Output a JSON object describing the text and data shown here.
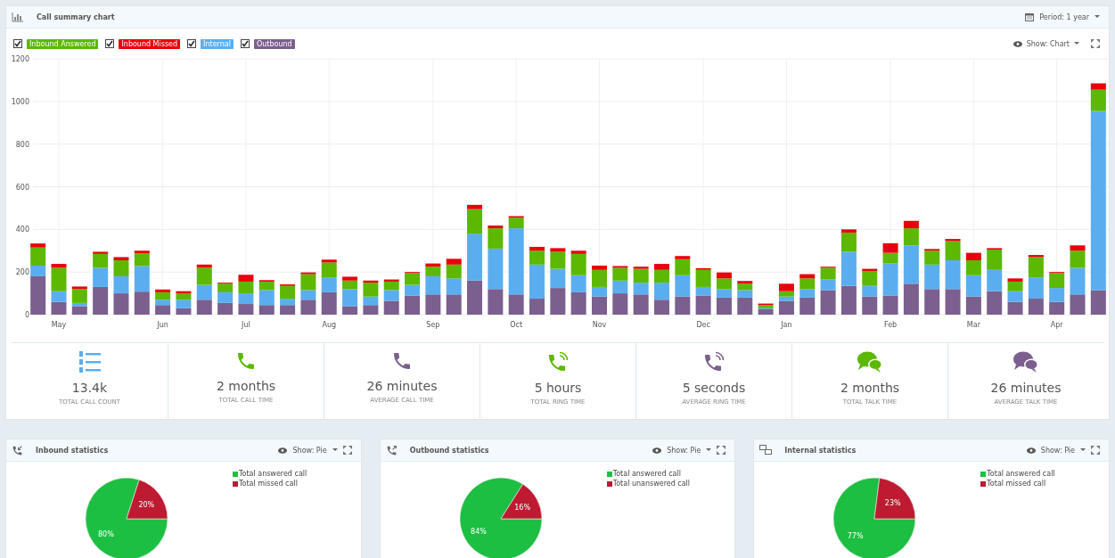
{
  "summary": {
    "title": "Call summary chart",
    "period": "Period: 1 year",
    "show": "Show: Chart",
    "legend": [
      {
        "checked": true
      },
      {
        "checked": true
      },
      {
        "checked": true
      },
      {
        "checked": true
      }
    ],
    "chart_data": {
      "type": "bar",
      "stacked": true,
      "orientation": "vertical",
      "categories": [
        null,
        "May",
        null,
        null,
        null,
        null,
        "Jun",
        null,
        null,
        null,
        "Jul",
        null,
        null,
        null,
        "Aug",
        null,
        null,
        null,
        null,
        "Sep",
        null,
        null,
        null,
        "Oct",
        null,
        null,
        null,
        "Nov",
        null,
        null,
        null,
        null,
        "Dec",
        null,
        null,
        null,
        "Jan",
        null,
        null,
        null,
        null,
        "Feb",
        null,
        null,
        null,
        "Mar",
        null,
        null,
        null,
        "Apr",
        null,
        null
      ],
      "ylim": [
        0,
        1200
      ],
      "yticks": [
        0,
        200,
        400,
        600,
        800,
        1000,
        1200
      ],
      "grid": true,
      "series": [
        {
          "name": "Outbound",
          "color": "#7b5f8e",
          "values": [
            180,
            60,
            40,
            130,
            100,
            108,
            45,
            30,
            70,
            55,
            50,
            45,
            45,
            70,
            105,
            40,
            45,
            65,
            90,
            95,
            95,
            160,
            120,
            95,
            75,
            125,
            105,
            85,
            100,
            95,
            70,
            85,
            90,
            80,
            80,
            25,
            65,
            80,
            115,
            135,
            85,
            90,
            145,
            120,
            120,
            85,
            110,
            60,
            75,
            60,
            95,
            115
          ]
        },
        {
          "name": "Internal",
          "color": "#5aaef0",
          "values": [
            50,
            50,
            15,
            90,
            80,
            120,
            25,
            40,
            70,
            50,
            50,
            70,
            30,
            45,
            70,
            80,
            40,
            50,
            50,
            85,
            75,
            220,
            190,
            310,
            160,
            90,
            80,
            45,
            60,
            55,
            80,
            100,
            40,
            40,
            35,
            5,
            20,
            40,
            50,
            160,
            50,
            150,
            180,
            115,
            135,
            100,
            100,
            50,
            100,
            65,
            125,
            840
          ]
        },
        {
          "name": "Inbound Answered",
          "color": "#5cb800",
          "values": [
            85,
            110,
            65,
            65,
            75,
            60,
            35,
            30,
            80,
            40,
            55,
            40,
            60,
            75,
            70,
            40,
            65,
            40,
            55,
            45,
            65,
            115,
            95,
            50,
            65,
            80,
            100,
            80,
            60,
            65,
            60,
            75,
            80,
            50,
            30,
            15,
            25,
            50,
            55,
            90,
            70,
            50,
            80,
            65,
            90,
            70,
            95,
            45,
            95,
            70,
            80,
            100
          ]
        },
        {
          "name": "Inbound Missed",
          "color": "#e8000b",
          "values": [
            19,
            18,
            12,
            10,
            15,
            12,
            13,
            10,
            15,
            5,
            32,
            7,
            7,
            8,
            13,
            18,
            10,
            10,
            5,
            15,
            27,
            20,
            13,
            7,
            18,
            17,
            15,
            20,
            8,
            10,
            28,
            15,
            8,
            28,
            13,
            7,
            35,
            20,
            5,
            15,
            10,
            45,
            35,
            8,
            10,
            35,
            7,
            15,
            10,
            5,
            25,
            30
          ]
        }
      ]
    }
  },
  "stats": [
    {
      "kind": "list",
      "color": "#5aaef0",
      "value": "13.4k",
      "label": "TOTAL CALL COUNT"
    },
    {
      "kind": "phone",
      "color": "#5cb800",
      "value": "2 months",
      "label": "TOTAL CALL TIME"
    },
    {
      "kind": "phone",
      "color": "#7b5f8e",
      "value": "26 minutes",
      "label": "AVERAGE CALL TIME"
    },
    {
      "kind": "ringing",
      "color": "#5cb800",
      "value": "5 hours",
      "label": "TOTAL RING TIME"
    },
    {
      "kind": "ringing",
      "color": "#7b5f8e",
      "value": "5 seconds",
      "label": "AVERAGE RING TIME"
    },
    {
      "kind": "chat",
      "color": "#5cb800",
      "value": "2 months",
      "label": "TOTAL TALK TIME"
    },
    {
      "kind": "chat",
      "color": "#7b5f8e",
      "value": "26 minutes",
      "label": "AVERAGE TALK TIME"
    }
  ],
  "panels": [
    {
      "kind": "inbound",
      "title": "Inbound statistics",
      "show": "Show: Pie",
      "chart_data": {
        "type": "pie",
        "categories": [
          "Total answered call",
          "Total missed call"
        ],
        "values": [
          80,
          20
        ],
        "colors": [
          "#1dbf42",
          "#be1a32"
        ],
        "value_labels": [
          "80%",
          "20%"
        ]
      }
    },
    {
      "kind": "outbound",
      "title": "Outbound statistics",
      "show": "Show: Pie",
      "chart_data": {
        "type": "pie",
        "categories": [
          "Total answered call",
          "Total unanswered call"
        ],
        "values": [
          84,
          16
        ],
        "colors": [
          "#1dbf42",
          "#be1a32"
        ],
        "value_labels": [
          "84%",
          "16%"
        ]
      }
    },
    {
      "kind": "internal",
      "title": "Internal statistics",
      "show": "Show: Pie",
      "chart_data": {
        "type": "pie",
        "categories": [
          "Total answered call",
          "Total missed call"
        ],
        "values": [
          77,
          23
        ],
        "colors": [
          "#1dbf42",
          "#be1a32"
        ],
        "value_labels": [
          "77%",
          "23%"
        ]
      }
    }
  ]
}
